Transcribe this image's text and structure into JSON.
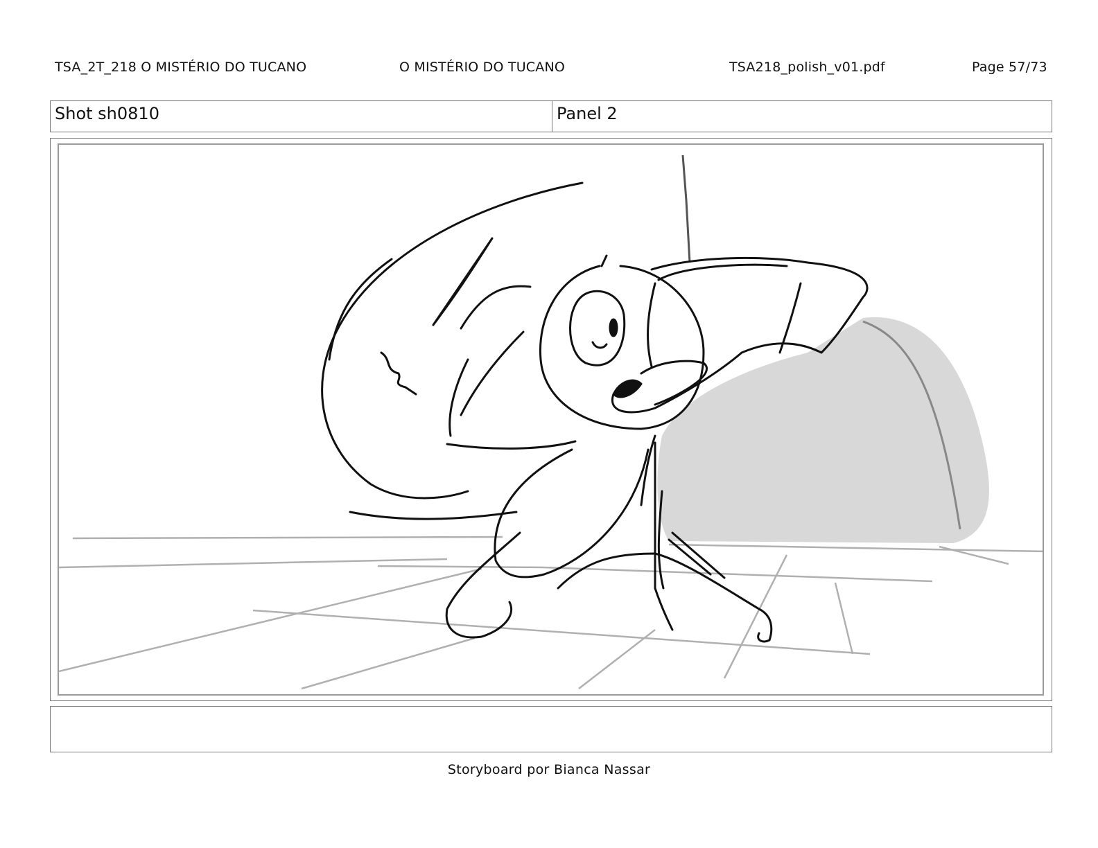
{
  "header": {
    "episode_title": "TSA_2T_218  O MISTÉRIO DO TUCANO",
    "title": "O MISTÉRIO DO TUCANO",
    "file_name": "TSA218_polish_v01.pdf",
    "page": "Page 57/73"
  },
  "shot": {
    "shot_label": "Shot sh0810",
    "panel_label": "Panel 2"
  },
  "panel": {
    "drawing": "storyboard-sketch-toucan"
  },
  "notes": {
    "text": ""
  },
  "footer": {
    "credit": "Storyboard por Bianca Nassar"
  },
  "colors": {
    "frame_border": "#777777",
    "sketch_line": "#111111",
    "floor_line": "#b0b0b0",
    "shadow_fill": "#d8d8d8"
  }
}
